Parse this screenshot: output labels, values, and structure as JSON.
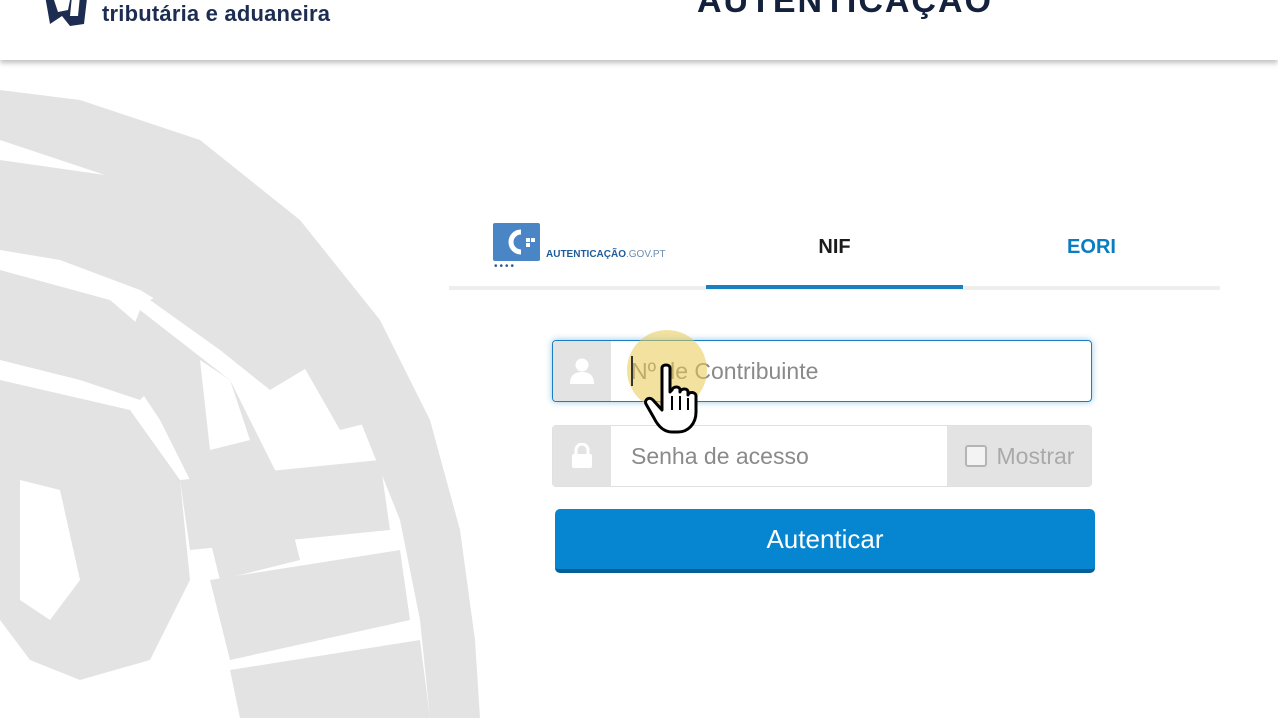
{
  "header": {
    "logo_text": "tributária e aduaneira",
    "page_title": "AUTENTICAÇÃO"
  },
  "tabs": {
    "gov": {
      "brand_main": "AUTENTICAÇÃO",
      "brand_suffix": ".GOV.PT"
    },
    "nif": {
      "label": "NIF",
      "active": true
    },
    "eori": {
      "label": "EORI"
    }
  },
  "form": {
    "nif_placeholder": "Nº de Contribuinte",
    "nif_value": "",
    "password_placeholder": "Senha de acesso",
    "password_value": "",
    "show_password_label": "Mostrar",
    "show_password_checked": false,
    "submit_label": "Autenticar"
  },
  "icons": {
    "user": "user-icon",
    "lock": "lock-icon",
    "cursor": "hand-pointer-icon"
  },
  "colors": {
    "primary": "#0686d0",
    "primary_dark": "#035f95",
    "tab_underline": "#1a7fc1",
    "eori_link": "#0a7cc2",
    "header_title": "#14213d"
  }
}
